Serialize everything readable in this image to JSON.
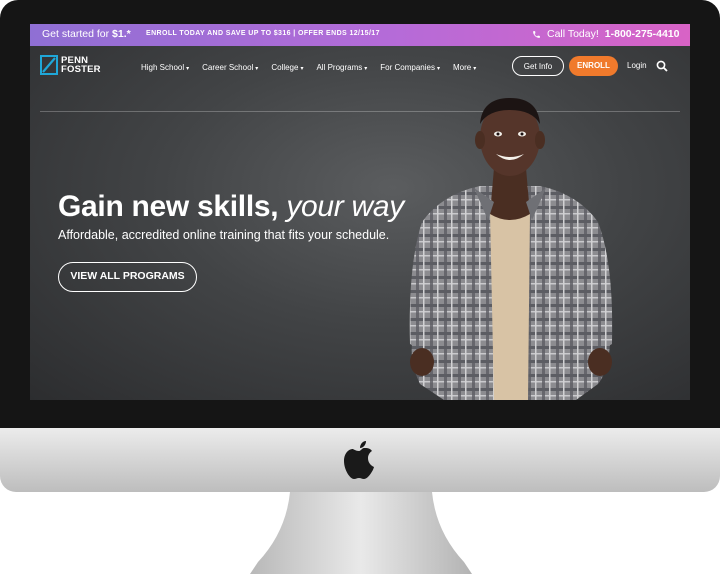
{
  "topbar": {
    "get_started_prefix": "Get started for ",
    "get_started_price": "$1.*",
    "promo": "ENROLL TODAY AND SAVE UP TO $316 | OFFER ENDS 12/15/17",
    "call_label": "Call Today!",
    "phone": "1-800-275-4410"
  },
  "logo": {
    "line1": "PENN",
    "line2": "FOSTER"
  },
  "nav": {
    "items": [
      {
        "label": "High School"
      },
      {
        "label": "Career School"
      },
      {
        "label": "College"
      },
      {
        "label": "All Programs"
      },
      {
        "label": "For Companies"
      },
      {
        "label": "More"
      }
    ],
    "get_info": "Get Info",
    "enroll": "ENROLL",
    "login": "Login"
  },
  "hero": {
    "headline_main": "Gain new skills, ",
    "headline_emph": "your way",
    "subhead": "Affordable, accredited online training that fits your schedule.",
    "cta": "VIEW ALL PROGRAMS"
  },
  "colors": {
    "enroll": "#f07a2c",
    "topbar_start": "#8f6fd4",
    "topbar_end": "#d863c6"
  },
  "icons": [
    "phone-icon",
    "chevron-down-icon",
    "search-icon",
    "apple-logo-icon",
    "penn-foster-logo-icon"
  ]
}
